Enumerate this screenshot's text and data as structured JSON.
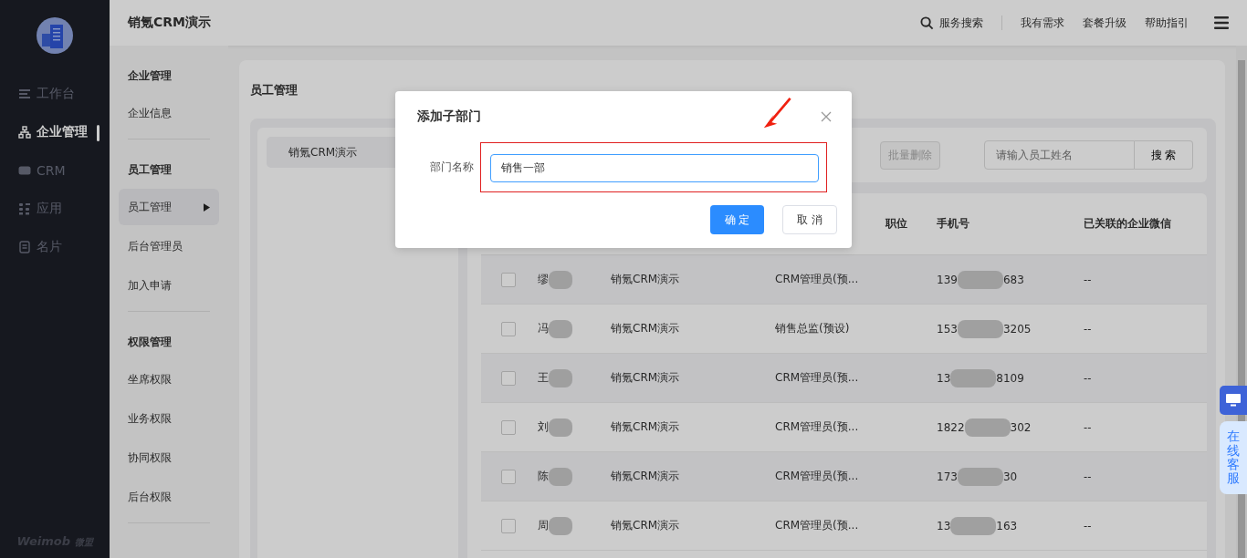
{
  "sidebar": {
    "items": [
      {
        "label": "工作台",
        "kind": "lines",
        "selected": false
      },
      {
        "label": "企业管理",
        "kind": "org",
        "selected": true
      },
      {
        "label": "CRM",
        "kind": "crm",
        "selected": false
      },
      {
        "label": "应用",
        "kind": "apps",
        "selected": false
      },
      {
        "label": "名片",
        "kind": "card",
        "selected": false
      }
    ],
    "brand": "Weimob",
    "brand_cn": "微盟"
  },
  "header": {
    "title": "销氪CRM演示",
    "actions": [
      {
        "label": "服务搜索",
        "kind": "search"
      },
      {
        "label": "我有需求",
        "kind": "link"
      },
      {
        "label": "套餐升级",
        "kind": "link"
      },
      {
        "label": "帮助指引",
        "kind": "link"
      }
    ]
  },
  "submenu": {
    "groups": [
      {
        "title": "企业管理",
        "items": [
          {
            "label": "企业信息",
            "selected": false
          }
        ]
      },
      {
        "title": "员工管理",
        "items": [
          {
            "label": "员工管理",
            "selected": true
          },
          {
            "label": "后台管理员",
            "selected": false
          },
          {
            "label": "加入申请",
            "selected": false
          }
        ]
      },
      {
        "title": "权限管理",
        "items": [
          {
            "label": "坐席权限",
            "selected": false
          },
          {
            "label": "业务权限",
            "selected": false
          },
          {
            "label": "协同权限",
            "selected": false
          },
          {
            "label": "后台权限",
            "selected": false
          }
        ]
      }
    ]
  },
  "page": {
    "title": "员工管理",
    "tree": [
      {
        "label": "销氪CRM演示",
        "selected": true
      }
    ],
    "toolbar": {
      "buttons": [
        "批量删除"
      ],
      "search": {
        "placeholder": "请输入员工姓名",
        "button": "搜 索"
      }
    },
    "table": {
      "columns": [
        "职位",
        "手机号",
        "已关联的企业微信"
      ],
      "rows": [
        {
          "name": "缪",
          "department": "销氪CRM演示",
          "role": "CRM管理员(预...",
          "phone_start": "139",
          "phone_end": "683",
          "wechat": "--",
          "checked": false
        },
        {
          "name": "冯",
          "department": "销氪CRM演示",
          "role": "销售总监(预设)",
          "phone_start": "153",
          "phone_end": "3205",
          "wechat": "--",
          "checked": false
        },
        {
          "name": "王",
          "department": "销氪CRM演示",
          "role": "CRM管理员(预...",
          "phone_start": "13",
          "phone_end": "8109",
          "wechat": "--",
          "checked": false
        },
        {
          "name": "刘",
          "department": "销氪CRM演示",
          "role": "CRM管理员(预...",
          "phone_start": "1822",
          "phone_end": "302",
          "wechat": "--",
          "checked": false
        },
        {
          "name": "陈",
          "department": "销氪CRM演示",
          "role": "CRM管理员(预...",
          "phone_start": "173",
          "phone_end": "30",
          "wechat": "--",
          "checked": false
        },
        {
          "name": "周",
          "department": "销氪CRM演示",
          "role": "CRM管理员(预...",
          "phone_start": "13",
          "phone_end": "163",
          "wechat": "--",
          "checked": false
        }
      ]
    }
  },
  "dialog": {
    "title": "添加子部门",
    "field": {
      "label": "部门名称",
      "value": "销售一部"
    },
    "buttons": [
      {
        "label": "确 定",
        "kind": "primary"
      },
      {
        "label": "取 消",
        "kind": "default"
      }
    ]
  },
  "support": {
    "label": "在线客服"
  }
}
